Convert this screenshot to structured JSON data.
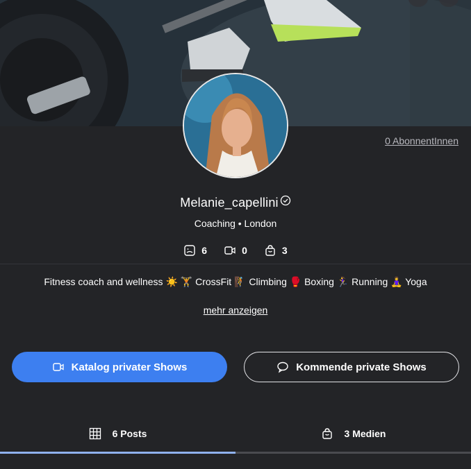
{
  "profile": {
    "subscribers_label": "0 AbonnentInnen",
    "username": "Melanie_capellini",
    "meta": "Coaching • London",
    "bio": "Fitness coach and wellness ☀️ 🏋️ CrossFit 🧗 Climbing 🥊 Boxing 🏃‍♀️ Running 🧘‍♀️ Yoga",
    "more_label": "mehr anzeigen"
  },
  "stats": {
    "posts": "6",
    "videos": "0",
    "media": "3"
  },
  "buttons": {
    "catalog_label": "Katalog privater Shows",
    "upcoming_label": "Kommende private Shows"
  },
  "tabs": {
    "posts_label": "6 Posts",
    "media_label": "3 Medien",
    "active_fraction": 0.5
  },
  "colors": {
    "background": "#232427",
    "accent": "#3d7ff0",
    "tab_active": "#8fb1ee"
  }
}
